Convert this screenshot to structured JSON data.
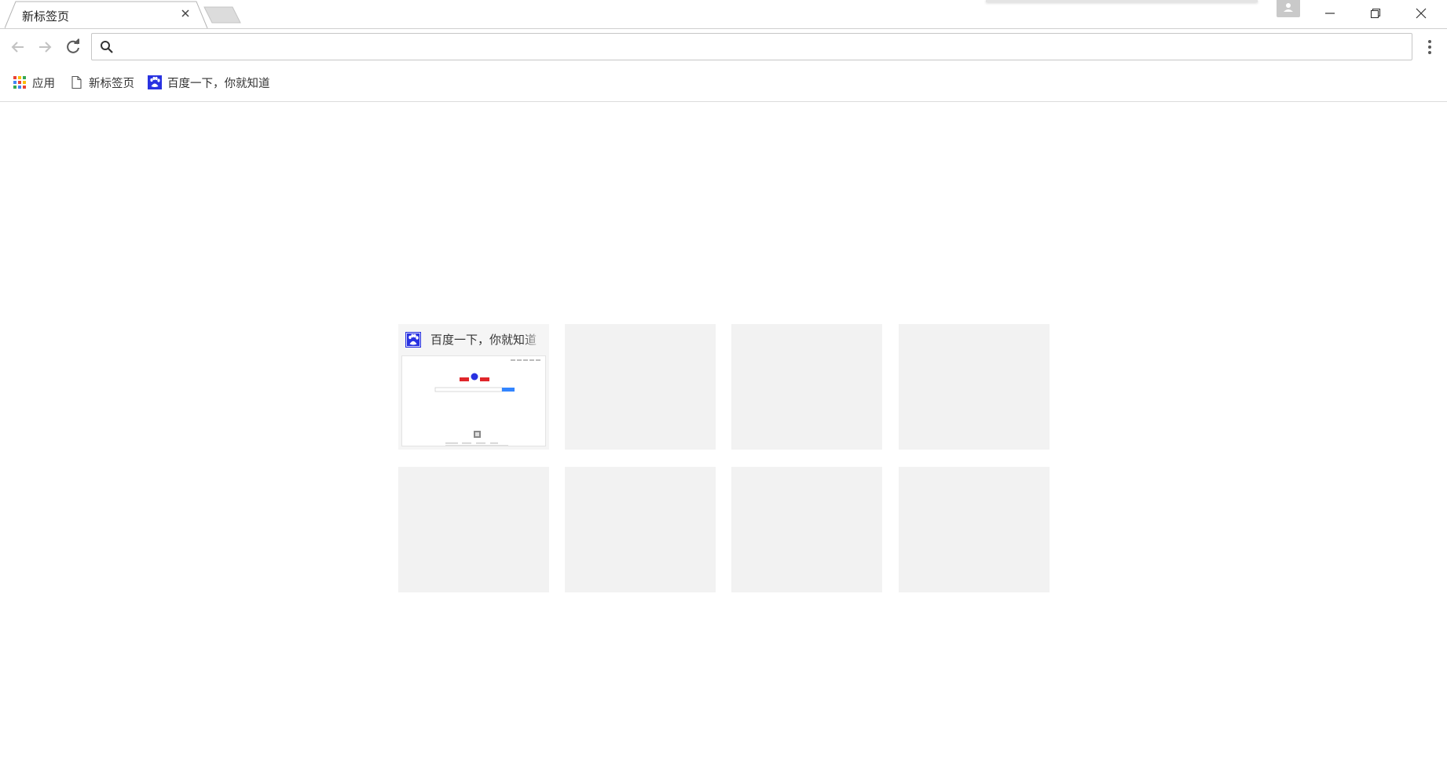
{
  "browser": {
    "tab": {
      "title": "新标签页"
    },
    "omnibox": {
      "value": "",
      "placeholder": ""
    }
  },
  "bookmarks": [
    {
      "label": "应用",
      "icon": "apps-grid-icon"
    },
    {
      "label": "新标签页",
      "icon": "page-icon"
    },
    {
      "label": "百度一下，你就知道",
      "icon": "baidu-paw-icon"
    }
  ],
  "most_visited": {
    "tiles": [
      {
        "title": "百度一下，你就知道",
        "icon": "baidu-paw-icon",
        "has_thumbnail": true
      },
      {
        "title": "",
        "has_thumbnail": false
      },
      {
        "title": "",
        "has_thumbnail": false
      },
      {
        "title": "",
        "has_thumbnail": false
      },
      {
        "title": "",
        "has_thumbnail": false
      },
      {
        "title": "",
        "has_thumbnail": false
      },
      {
        "title": "",
        "has_thumbnail": false
      },
      {
        "title": "",
        "has_thumbnail": false
      }
    ]
  },
  "colors": {
    "accent_blue": "#4285f4",
    "baidu_blue": "#2932e1",
    "tile_empty": "#f2f2f2",
    "icon_gray": "#5f6368"
  }
}
